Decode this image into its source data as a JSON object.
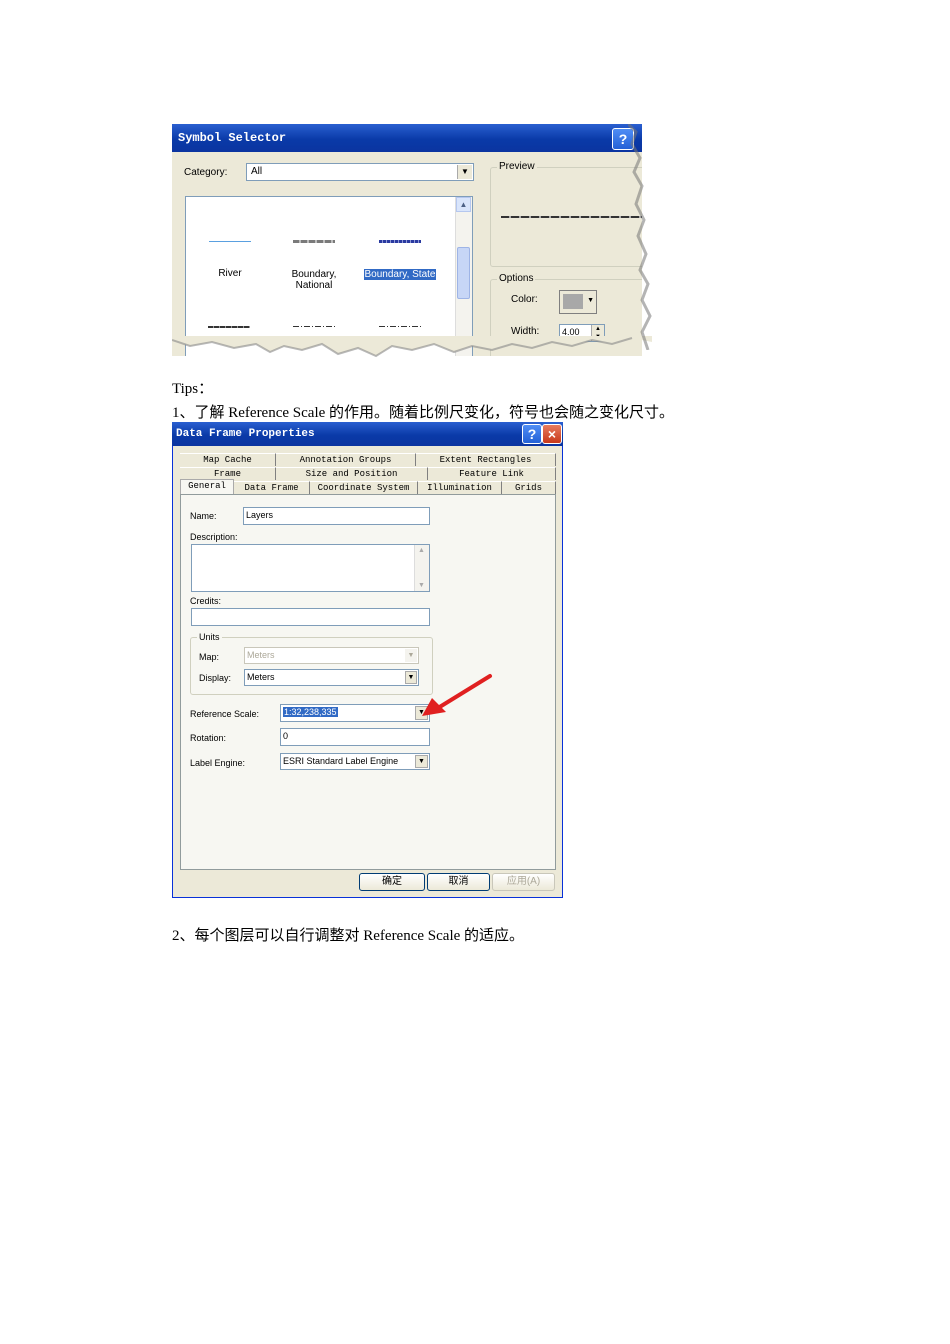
{
  "symbol_selector": {
    "title": "Symbol Selector",
    "category_label": "Category:",
    "category_value": "All",
    "preview_label": "Preview",
    "options_label": "Options",
    "color_label": "Color:",
    "width_label": "Width:",
    "width_value": "4.00",
    "symbols": [
      {
        "label_line1": "River",
        "label_line2": "",
        "color": "#5aa0e0"
      },
      {
        "label_line1": "Boundary,",
        "label_line2": "National",
        "color": "#7a7a7a"
      },
      {
        "label_line1": "Boundary, State",
        "label_line2": "",
        "color": "#2a3aa0"
      }
    ],
    "help_glyph": "?",
    "close_glyph": "×"
  },
  "doc": {
    "tips": "Tips：",
    "line1": "1、了解 Reference Scale 的作用。随着比例尺变化，符号也会随之变化尺寸。",
    "line2": "2、每个图层可以自行调整对 Reference Scale 的适应。"
  },
  "data_frame_properties": {
    "title": "Data Frame Properties",
    "help_glyph": "?",
    "close_glyph": "×",
    "tabs_row1": [
      "Map Cache",
      "Annotation Groups",
      "Extent Rectangles"
    ],
    "tabs_row2": [
      "Frame",
      "Size and Position",
      "Feature Link"
    ],
    "tabs_row3": [
      "General",
      "Data Frame",
      "Coordinate System",
      "Illumination",
      "Grids"
    ],
    "name_label": "Name:",
    "name_value": "Layers",
    "description_label": "Description:",
    "credits_label": "Credits:",
    "units_label": "Units",
    "map_label": "Map:",
    "map_value": "Meters",
    "display_label": "Display:",
    "display_value": "Meters",
    "reference_scale_label": "Reference Scale:",
    "reference_scale_value": "1:32,238,335",
    "rotation_label": "Rotation:",
    "rotation_value": "0",
    "label_engine_label": "Label Engine:",
    "label_engine_value": "ESRI Standard Label Engine",
    "ok_button": "确定",
    "cancel_button": "取消",
    "apply_button": "应用(A)",
    "arrow_color": "#e02020"
  }
}
